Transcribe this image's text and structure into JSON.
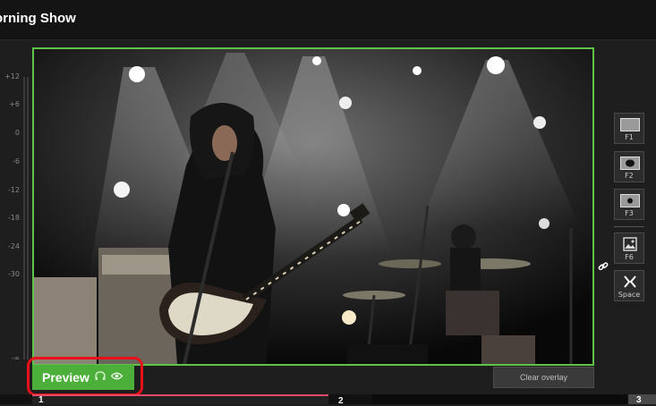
{
  "header": {
    "title": "orning Show"
  },
  "meter": {
    "labels": [
      "+12",
      "+6",
      "0",
      "-6",
      "-12",
      "-18",
      "-24",
      "-30",
      "-∞"
    ]
  },
  "preview": {
    "label": "Preview",
    "headphones_icon": "headphones-icon",
    "eye_icon": "eye-icon"
  },
  "clear_overlay": {
    "label": "Clear overlay"
  },
  "side_tools": [
    {
      "key": "F1",
      "icon": "fullscreen-layout-icon"
    },
    {
      "key": "F2",
      "icon": "centered-layout-icon"
    },
    {
      "key": "F3",
      "icon": "small-centered-layout-icon"
    },
    {
      "key": "F6",
      "icon": "image-overlay-icon"
    },
    {
      "key": "Space",
      "icon": "swap-icon"
    }
  ],
  "thumbnails": [
    {
      "num": "1"
    },
    {
      "num": "2"
    },
    {
      "num": "3"
    }
  ],
  "colors": {
    "preview_green": "#4caf3a",
    "frame_green": "#5fc34a",
    "highlight_red": "#e8101a",
    "thumb_accent": "#e64a67"
  }
}
